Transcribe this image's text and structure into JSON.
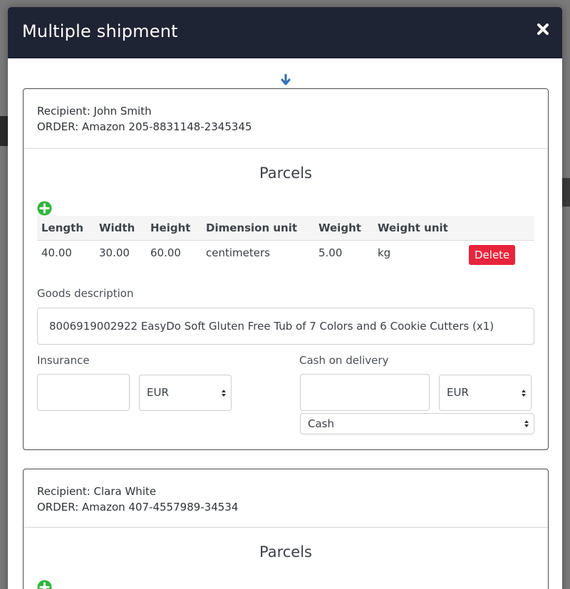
{
  "modal": {
    "title": "Multiple shipment",
    "close_icon": "close-icon",
    "scroll_hint_icon": "arrow-down-icon"
  },
  "colors": {
    "header_bg": "#1f2434",
    "delete_bg": "#e8243d",
    "add_green": "#2db53c",
    "arrow_blue": "#2f6fb3"
  },
  "shipments": [
    {
      "recipient": "Recipient: John Smith",
      "order": "ORDER: Amazon 205-8831148-2345345",
      "parcels_title": "Parcels",
      "columns": [
        "Length",
        "Width",
        "Height",
        "Dimension unit",
        "Weight",
        "Weight unit"
      ],
      "rows": [
        {
          "length": "40.00",
          "width": "30.00",
          "height": "60.00",
          "dimension_unit": "centimeters",
          "weight": "5.00",
          "weight_unit": "kg",
          "delete_label": "Delete"
        }
      ],
      "goods_label": "Goods description",
      "goods_value": "8006919002922 EasyDo Soft Gluten Free Tub of 7 Colors and 6 Cookie Cutters (x1)",
      "insurance_label": "Insurance",
      "insurance_value": "",
      "insurance_currency": "EUR",
      "cod_label": "Cash on delivery",
      "cod_value": "",
      "cod_currency": "EUR",
      "cod_method": "Cash"
    },
    {
      "recipient": "Recipient: Clara White",
      "order": "ORDER: Amazon 407-4557989-34534",
      "parcels_title": "Parcels"
    }
  ]
}
